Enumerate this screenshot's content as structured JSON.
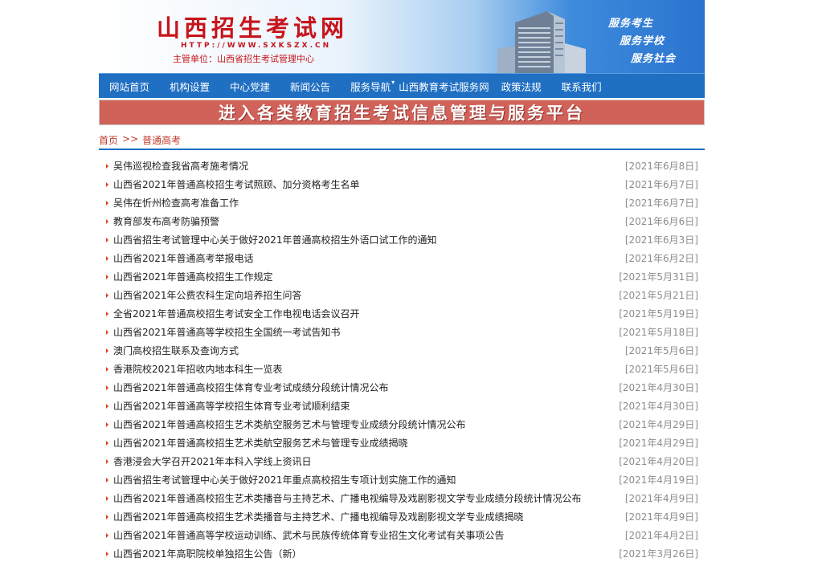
{
  "header": {
    "title": "山西招生考试网",
    "url": "HTTP://WWW.SXKSZX.CN",
    "org": "主管单位：山西省招生考试管理中心",
    "slogans": [
      "服务考生",
      "服务学校",
      "服务社会"
    ]
  },
  "nav": [
    {
      "label": "网站首页",
      "caret": ""
    },
    {
      "label": "机构设置",
      "caret": ""
    },
    {
      "label": "中心党建",
      "caret": ""
    },
    {
      "label": "新闻公告",
      "caret": ""
    },
    {
      "label": "服务导航",
      "caret": "▾"
    },
    {
      "label": "山西教育考试服务网",
      "caret": ""
    },
    {
      "label": "政策法规",
      "caret": ""
    },
    {
      "label": "联系我们",
      "caret": ""
    }
  ],
  "platform_banner": "进入各类教育招生考试信息管理与服务平台",
  "breadcrumb": {
    "home": "首页",
    "sep": ">>",
    "current": "普通高考"
  },
  "articles": [
    {
      "title": "吴伟巡视检查我省高考施考情况",
      "date": "[2021年6月8日]"
    },
    {
      "title": "山西省2021年普通高校招生考试照顾、加分资格考生名单",
      "date": "[2021年6月7日]"
    },
    {
      "title": "吴伟在忻州检查高考准备工作",
      "date": "[2021年6月7日]"
    },
    {
      "title": "教育部发布高考防骗预警",
      "date": "[2021年6月6日]"
    },
    {
      "title": "山西省招生考试管理中心关于做好2021年普通高校招生外语口试工作的通知",
      "date": "[2021年6月3日]"
    },
    {
      "title": "山西省2021年普通高考举报电话",
      "date": "[2021年6月2日]"
    },
    {
      "title": "山西省2021年普通高校招生工作规定",
      "date": "[2021年5月31日]"
    },
    {
      "title": "山西省2021年公费农科生定向培养招生问答",
      "date": "[2021年5月21日]"
    },
    {
      "title": "全省2021年普通高校招生考试安全工作电视电话会议召开",
      "date": "[2021年5月19日]"
    },
    {
      "title": "山西省2021年普通高等学校招生全国统一考试告知书",
      "date": "[2021年5月18日]"
    },
    {
      "title": "澳门高校招生联系及查询方式",
      "date": "[2021年5月6日]"
    },
    {
      "title": "香港院校2021年招收内地本科生一览表",
      "date": "[2021年5月6日]"
    },
    {
      "title": "山西省2021年普通高校招生体育专业考试成绩分段统计情况公布",
      "date": "[2021年4月30日]"
    },
    {
      "title": "山西省2021年普通高等学校招生体育专业考试顺利结束",
      "date": "[2021年4月30日]"
    },
    {
      "title": "山西省2021年普通高校招生艺术类航空服务艺术与管理专业成绩分段统计情况公布",
      "date": "[2021年4月29日]"
    },
    {
      "title": "山西省2021年普通高校招生艺术类航空服务艺术与管理专业成绩揭晓",
      "date": "[2021年4月29日]"
    },
    {
      "title": "香港浸会大学召开2021年本科入学线上资讯日",
      "date": "[2021年4月20日]"
    },
    {
      "title": "山西省招生考试管理中心关于做好2021年重点高校招生专项计划实施工作的通知",
      "date": "[2021年4月19日]"
    },
    {
      "title": "山西省2021年普通高校招生艺术类播音与主持艺术、广播电视编导及戏剧影视文学专业成绩分段统计情况公布",
      "date": "[2021年4月9日]"
    },
    {
      "title": "山西省2021年普通高校招生艺术类播音与主持艺术、广播电视编导及戏剧影视文学专业成绩揭晓",
      "date": "[2021年4月9日]"
    },
    {
      "title": "山西省2021年普通高等学校运动训练、武术与民族传统体育专业招生文化考试有关事项公告",
      "date": "[2021年4月2日]"
    },
    {
      "title": "山西省2021年高职院校单独招生公告（新）",
      "date": "[2021年3月26日]"
    }
  ],
  "colors": {
    "nav": "#1f6fc2",
    "title_red": "#c7141b",
    "banner": "#d0625a"
  },
  "icons": {
    "bullet": "triangle-bullet-icon",
    "building": "building-icon"
  }
}
